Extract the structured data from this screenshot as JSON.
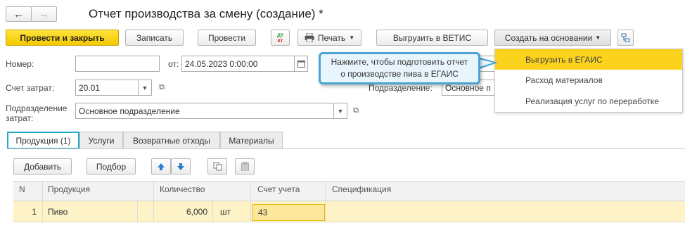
{
  "window": {
    "title": "Отчет производства за смену (создание) *"
  },
  "nav": {
    "back_icon": "←",
    "forward_icon": "→"
  },
  "toolbar": {
    "post_close": "Провести и закрыть",
    "save": "Записать",
    "post": "Провести",
    "dtkt_top": "дт",
    "dtkt_bottom": "кт",
    "print": "Печать",
    "vetis": "Выгрузить в ВЕТИС",
    "create_basis": "Создать на основании"
  },
  "dropdown": {
    "items": [
      {
        "label": "Выгрузить в ЕГАИС",
        "highlighted": true
      },
      {
        "label": "Расход материалов",
        "highlighted": false
      },
      {
        "label": "Реализация услуг по переработке",
        "highlighted": false
      }
    ]
  },
  "callout": {
    "line1": "Нажмите, чтобы подготовить отчет",
    "line2": "о производстве пива в ЕГАИС"
  },
  "form": {
    "number_label": "Номер:",
    "number_value": "",
    "date_label": "от:",
    "date_value": "24.05.2023  0:00:00",
    "cost_account_label": "Счет затрат:",
    "cost_account_value": "20.01",
    "division_label": "Подразделение:",
    "division_value": "Основное п",
    "cost_division_label_1": "Подразделение",
    "cost_division_label_2": "затрат:",
    "cost_division_value": "Основное подразделение"
  },
  "tabs": [
    {
      "label": "Продукция (1)",
      "active": true
    },
    {
      "label": "Услуги",
      "active": false
    },
    {
      "label": "Возвратные отходы",
      "active": false
    },
    {
      "label": "Материалы",
      "active": false
    }
  ],
  "table_toolbar": {
    "add": "Добавить",
    "select": "Подбор"
  },
  "table": {
    "columns": [
      "N",
      "Продукция",
      "Количество",
      "Счет учета",
      "Спецификация"
    ],
    "rows": [
      {
        "n": "1",
        "product": "Пиво",
        "qty": "6,000",
        "unit": "шт",
        "account": "43",
        "spec": ""
      }
    ]
  },
  "colors": {
    "accent_yellow": "#f4c900",
    "tab_border": "#2aa8c8",
    "row_highlight": "#fdf3c6"
  }
}
